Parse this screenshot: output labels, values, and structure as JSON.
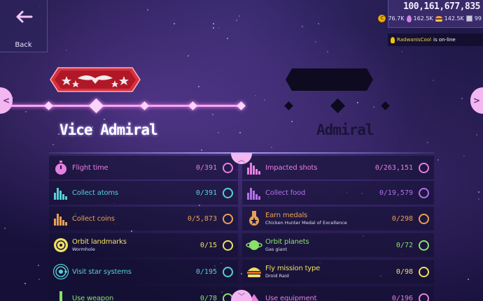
{
  "back": {
    "label": "Back"
  },
  "currency": {
    "coins_total": "100,161,677,835",
    "resources": [
      {
        "icon": "coin-icon",
        "value": "76.7K"
      },
      {
        "icon": "drop-icon",
        "value": "162.5K"
      },
      {
        "icon": "food-icon",
        "value": "142.5K"
      },
      {
        "icon": "chip-icon",
        "value": "99"
      }
    ]
  },
  "notification": {
    "player": "RadwanIsCool",
    "message": " is on-line"
  },
  "ranks": {
    "current": "Vice Admiral",
    "next": "Admiral"
  },
  "colors": {
    "pink": "#e77fe0",
    "teal": "#55d0d8",
    "orange": "#e8a055",
    "yellow": "#f0e060",
    "purple": "#b36fe8",
    "green": "#8ae06a",
    "gold": "#d8a048"
  },
  "tasks_left": [
    {
      "label": "Flight time",
      "sub": "",
      "progress": "0/391",
      "color": "#e77fe0",
      "icon": "stopwatch-icon"
    },
    {
      "label": "Collect atoms",
      "sub": "",
      "progress": "0/391",
      "color": "#55d0d8",
      "icon": "bar-graph-icon"
    },
    {
      "label": "Collect coins",
      "sub": "",
      "progress": "0/5,873",
      "color": "#e8a055",
      "icon": "bar-graph-icon"
    },
    {
      "label": "Orbit landmarks",
      "sub": "Wormhole",
      "progress": "0/15",
      "color": "#f0e060",
      "icon": "wormhole-icon"
    },
    {
      "label": "Visit star systems",
      "sub": "",
      "progress": "0/195",
      "color": "#55d0d8",
      "icon": "star-system-icon"
    },
    {
      "label": "Use weapon",
      "sub": "",
      "progress": "0/78",
      "color": "#8ae06a",
      "icon": "weapon-icon"
    }
  ],
  "tasks_right": [
    {
      "label": "Impacted shots",
      "sub": "",
      "progress": "0/263,151",
      "color": "#e77fe0",
      "icon": "bar-graph-icon"
    },
    {
      "label": "Collect food",
      "sub": "",
      "progress": "0/19,579",
      "color": "#b36fe8",
      "icon": "bar-graph-icon"
    },
    {
      "label": "Earn medals",
      "sub": "Chicken Hunter Medal of Excellence",
      "progress": "0/298",
      "color": "#e8a055",
      "icon": "medal-icon"
    },
    {
      "label": "Orbit planets",
      "sub": "Gas giant",
      "progress": "0/72",
      "color": "#8ae06a",
      "icon": "planet-icon"
    },
    {
      "label": "Fly mission type",
      "sub": "Droid Raid",
      "progress": "0/98",
      "color": "#f0e060",
      "icon": "burger-icon"
    },
    {
      "label": "Use equipment",
      "sub": "",
      "progress": "0/196",
      "color": "#e77fe0",
      "icon": "equipment-icon"
    }
  ]
}
